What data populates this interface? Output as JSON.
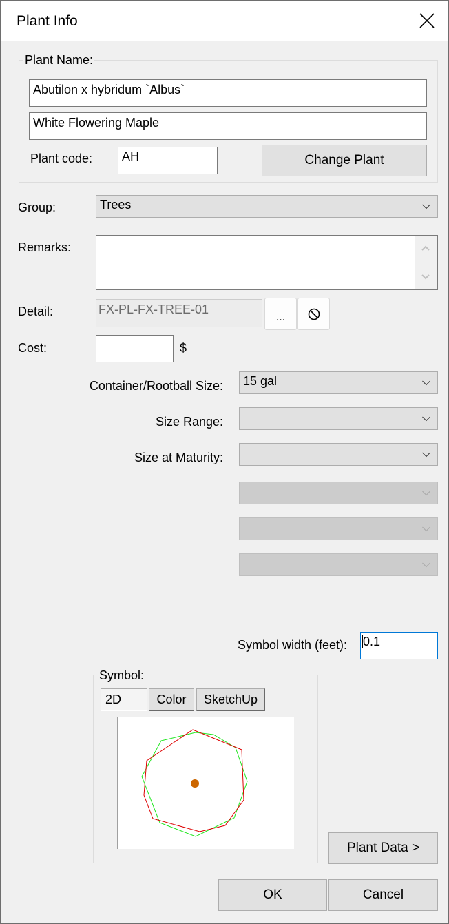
{
  "window": {
    "title": "Plant Info",
    "close_icon": "close-x-icon"
  },
  "plant_name": {
    "legend": "Plant Name:",
    "botanical_name": "Abutilon x hybridum `Albus`",
    "common_name": "White Flowering Maple",
    "code_label": "Plant code:",
    "code_value": "AH",
    "change_button": "Change Plant"
  },
  "group": {
    "label": "Group:",
    "value": "Trees"
  },
  "remarks": {
    "label": "Remarks:",
    "value": ""
  },
  "detail": {
    "label": "Detail:",
    "value": "FX-PL-FX-TREE-01",
    "browse_button": "...",
    "clear_icon": "prohibited-icon"
  },
  "cost": {
    "label": "Cost:",
    "value": "",
    "unit": "$"
  },
  "container_size": {
    "label": "Container/Rootball Size:",
    "value": "15 gal"
  },
  "size_range": {
    "label": "Size Range:",
    "value": ""
  },
  "size_at_maturity": {
    "label": "Size at Maturity:",
    "value": ""
  },
  "extra_combos": [
    {
      "value": "",
      "enabled": false
    },
    {
      "value": "",
      "enabled": false
    },
    {
      "value": "",
      "enabled": false
    }
  ],
  "symbol_width": {
    "label": "Symbol width (feet):",
    "value": "0.1"
  },
  "symbol": {
    "legend": "Symbol:",
    "tabs": [
      {
        "label": "2D",
        "active": true
      },
      {
        "label": "Color",
        "active": false
      },
      {
        "label": "SketchUp",
        "active": false
      }
    ],
    "preview": {
      "outline_colors": {
        "green": "#1ee61e",
        "red": "#dd0000",
        "center": "#cc6600"
      }
    }
  },
  "buttons": {
    "plant_data": "Plant Data >",
    "ok": "OK",
    "cancel": "Cancel"
  }
}
